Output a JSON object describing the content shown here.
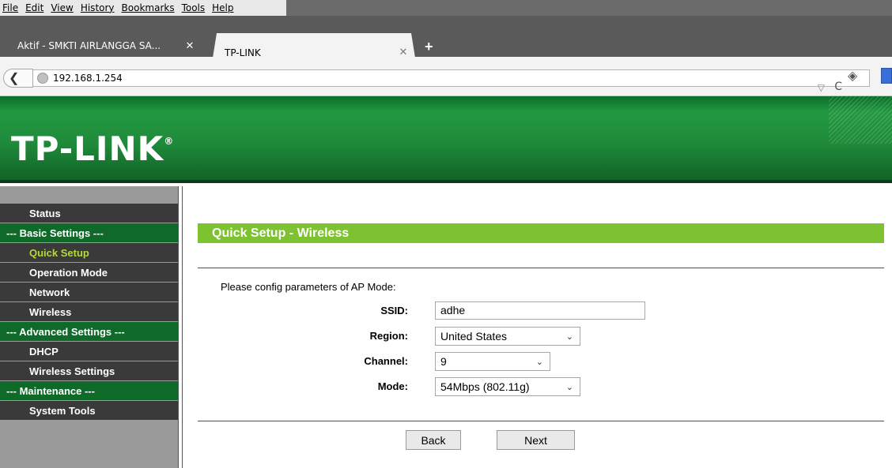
{
  "browser": {
    "menu": [
      "File",
      "Edit",
      "View",
      "History",
      "Bookmarks",
      "Tools",
      "Help"
    ],
    "tabs": [
      {
        "title": "Aktif - SMKTI AIRLANGGA SA...",
        "active": false,
        "close": "✕"
      },
      {
        "title": "TP-LINK",
        "active": true,
        "close": "✕"
      }
    ],
    "new_tab": "+",
    "url": "192.168.1.254",
    "url_dropdown": "▽",
    "reload": "C"
  },
  "banner": {
    "logo": "TP-LINK",
    "logo_mark": "®"
  },
  "sidebar": {
    "items": [
      {
        "label": "Status",
        "type": "item"
      },
      {
        "label": "--- Basic Settings ---",
        "type": "group"
      },
      {
        "label": "Quick Setup",
        "type": "item",
        "active": true
      },
      {
        "label": "Operation Mode",
        "type": "item"
      },
      {
        "label": "Network",
        "type": "item"
      },
      {
        "label": "Wireless",
        "type": "item"
      },
      {
        "label": "--- Advanced Settings ---",
        "type": "group"
      },
      {
        "label": "DHCP",
        "type": "item"
      },
      {
        "label": "Wireless Settings",
        "type": "item"
      },
      {
        "label": "--- Maintenance ---",
        "type": "group"
      },
      {
        "label": "System Tools",
        "type": "item"
      }
    ]
  },
  "main": {
    "title": "Quick Setup - Wireless",
    "intro": "Please config parameters of AP Mode:",
    "fields": {
      "ssid": {
        "label": "SSID:",
        "value": "adhe"
      },
      "region": {
        "label": "Region:",
        "value": "United States"
      },
      "channel": {
        "label": "Channel:",
        "value": "9"
      },
      "mode": {
        "label": "Mode:",
        "value": "54Mbps (802.11g)"
      }
    },
    "buttons": {
      "back": "Back",
      "next": "Next"
    }
  },
  "colors": {
    "banner_green": "#1f8a3a",
    "title_bar_green": "#7ec131",
    "nav_dark": "#3a3a3a",
    "nav_group_green": "#0f6a2a",
    "nav_active_text": "#b6d83a"
  }
}
